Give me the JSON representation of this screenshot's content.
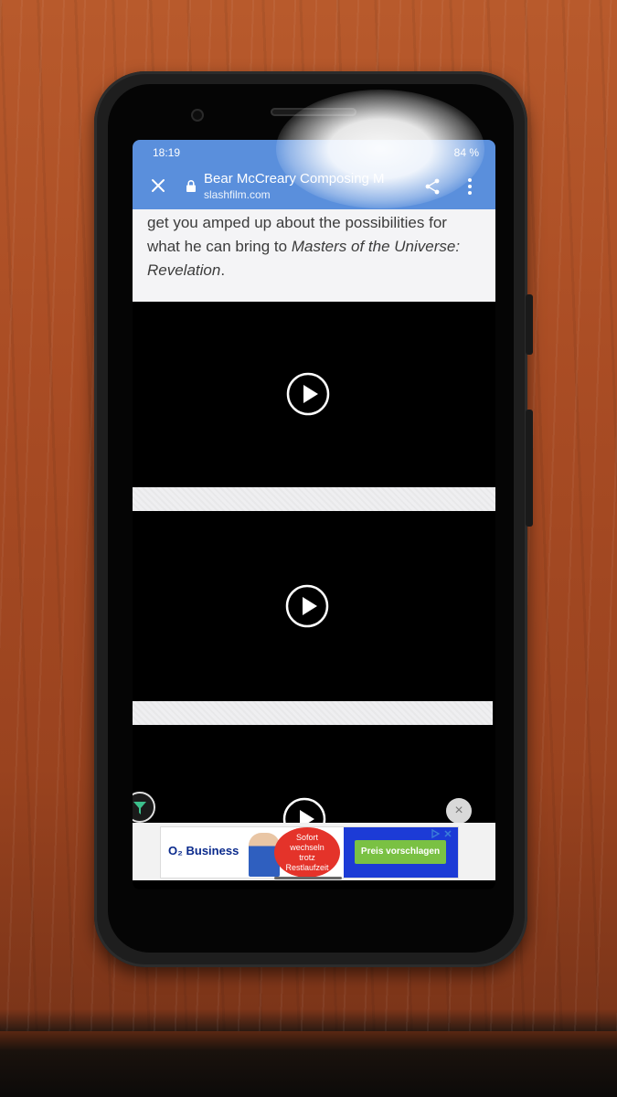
{
  "status_bar": {
    "time": "18:19",
    "battery": "84 %"
  },
  "browser": {
    "page_title": "Bear McCreary Composing M",
    "domain": "slashfilm.com"
  },
  "article": {
    "line1": "get you amped up about the possibilities for",
    "line2_prefix": "what he can bring to ",
    "line2_italic": "Masters of the Universe:",
    "line3_italic": "Revelation",
    "line3_suffix": "."
  },
  "ad": {
    "brand": "O₂ Business",
    "badge_lines": [
      "Sofort",
      "wechseln",
      "trotz",
      "Restlaufzeit"
    ],
    "cta": "Preis vorschlagen",
    "close_glyph": "×"
  },
  "icons": {
    "close": "close-icon",
    "lock": "lock-icon",
    "share": "share-icon",
    "menu": "more-vert-icon",
    "play": "play-icon",
    "filter": "filter-icon"
  },
  "colors": {
    "toolbar": "#5a8fdc",
    "article_bg": "#f4f4f6",
    "ad_cta": "#7ac143",
    "ad_badge": "#e4332a"
  }
}
